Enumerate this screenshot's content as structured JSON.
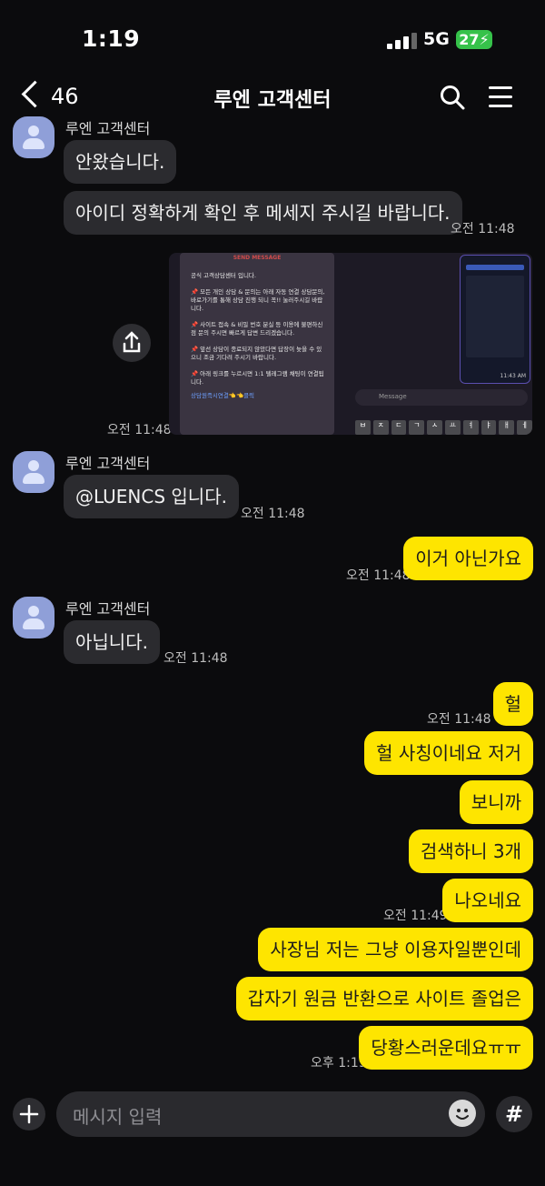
{
  "status_bar": {
    "time": "1:19",
    "network": "5G",
    "battery": "27"
  },
  "header": {
    "back_count": "46",
    "title": "루엔 고객센터"
  },
  "messages": {
    "m1": {
      "sender": "루엔 고객센터",
      "text": "안왔습니다."
    },
    "m2": {
      "text": "아이디 정확하게 확인 후 메세지 주시길 바랍니다.",
      "time": "오전 11:48"
    },
    "img": {
      "time": "오전 11:48",
      "panel_header": "SEND MESSAGE",
      "panel_lines": [
        "공식 고객상담센터 입니다.",
        "📌 모든 개인 상담 & 문의는 아래 자동 연결 상담문의,바로가기를 통해 상담 진행 되니 꼭!! 눌러주시길 바랍니다.",
        "📌 사이트 접속 & 비밀 번호 분실 등 이용에 불편하신 점 문의 주시면 빠르게 답변 드리겠습니다.",
        "📌 앞선 상담이 종료되지 않았다면 답장이 늦을 수 있으니 조금 기다려 주시기 바랍니다.",
        "📌 아래 링크를 누르시면 1:1 텔레그램 채팅이 연결됩니다.",
        "상담원즉시연결👈👈클릭"
      ],
      "phone_time": "11:43 AM",
      "msg_placeholder": "Message",
      "keyboard_keys": [
        "ㅂ",
        "ㅈ",
        "ㄷ",
        "ㄱ",
        "ㅅ",
        "ㅛ",
        "ㅕ",
        "ㅑ",
        "ㅐ",
        "ㅔ"
      ]
    },
    "m3": {
      "sender": "루엔 고객센터",
      "text": "@LUENCS 입니다.",
      "time": "오전 11:48"
    },
    "m4": {
      "text": "이거 아닌가요",
      "time": "오전 11:48"
    },
    "m5": {
      "sender": "루엔 고객센터",
      "text": "아닙니다.",
      "time": "오전 11:48"
    },
    "m6": {
      "text": "헐",
      "time": "오전 11:48"
    },
    "m7": {
      "text": "헐 사칭이네요 저거"
    },
    "m8": {
      "text": "보니까"
    },
    "m9": {
      "text": "검색하니 3개"
    },
    "m10": {
      "text": "나오네요",
      "time": "오전 11:49"
    },
    "m11": {
      "text": "사장님 저는 그냥 이용자일뿐인데"
    },
    "m12": {
      "text": "갑자기 원금 반환으로 사이트 졸업은"
    },
    "m13": {
      "text": "당황스러운데요ㅠㅠ",
      "time": "오후 1:19"
    }
  },
  "input_bar": {
    "placeholder": "메시지 입력",
    "hash_label": "#"
  },
  "colors": {
    "my_bubble": "#fee500",
    "their_bubble": "#2b2b2f",
    "avatar": "#8f9fd8",
    "background": "#0b0b0d"
  }
}
